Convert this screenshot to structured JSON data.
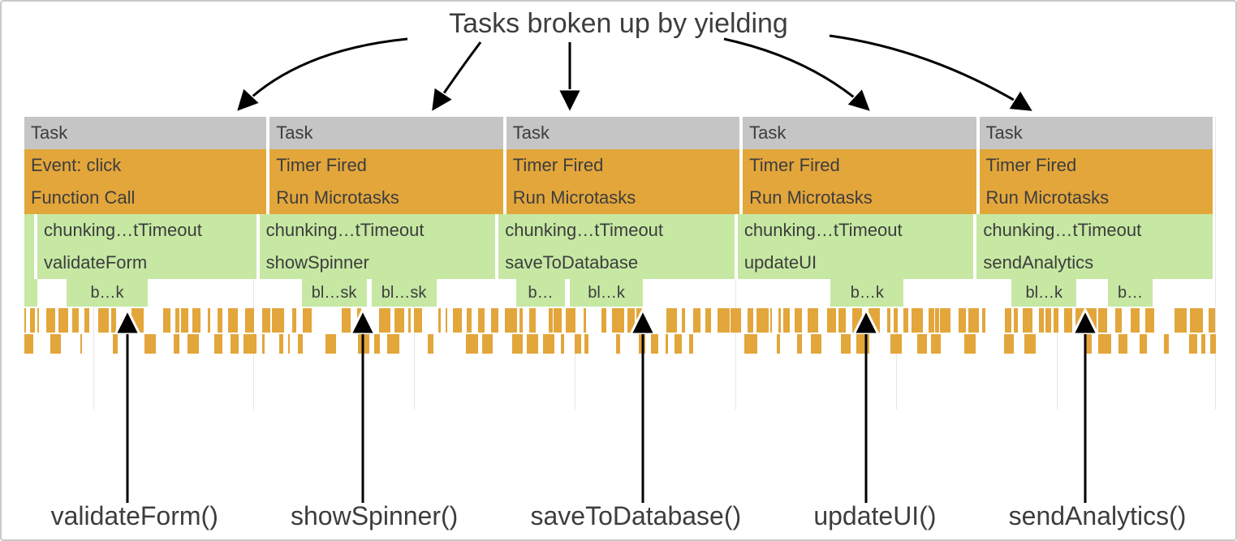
{
  "title": "Tasks broken up by yielding",
  "columns": [
    {
      "task": "Task",
      "event": "Event: click",
      "call": "Function Call",
      "chunk": "chunking…tTimeout",
      "func": "validateForm",
      "sub": [
        "b…k"
      ]
    },
    {
      "task": "Task",
      "event": "Timer Fired",
      "call": "Run Microtasks",
      "chunk": "chunking…tTimeout",
      "func": "showSpinner",
      "sub": [
        "bl…sk",
        "bl…sk"
      ]
    },
    {
      "task": "Task",
      "event": "Timer Fired",
      "call": "Run Microtasks",
      "chunk": "chunking…tTimeout",
      "func": "saveToDatabase",
      "sub": [
        "b…",
        "bl…k"
      ]
    },
    {
      "task": "Task",
      "event": "Timer Fired",
      "call": "Run Microtasks",
      "chunk": "chunking…tTimeout",
      "func": "updateUI",
      "sub": [
        "b…k"
      ]
    },
    {
      "task": "Task",
      "event": "Timer Fired",
      "call": "Run Microtasks",
      "chunk": "chunking…tTimeout",
      "func": "sendAnalytics",
      "sub": [
        "bl…k",
        "b…"
      ]
    }
  ],
  "bottom_labels": [
    "validateForm()",
    "showSpinner()",
    "saveToDatabase()",
    "updateUI()",
    "sendAnalytics()"
  ],
  "colors": {
    "task": "#c5c5c5",
    "scripting": "#E3A63B",
    "func": "#c6e8a3"
  }
}
